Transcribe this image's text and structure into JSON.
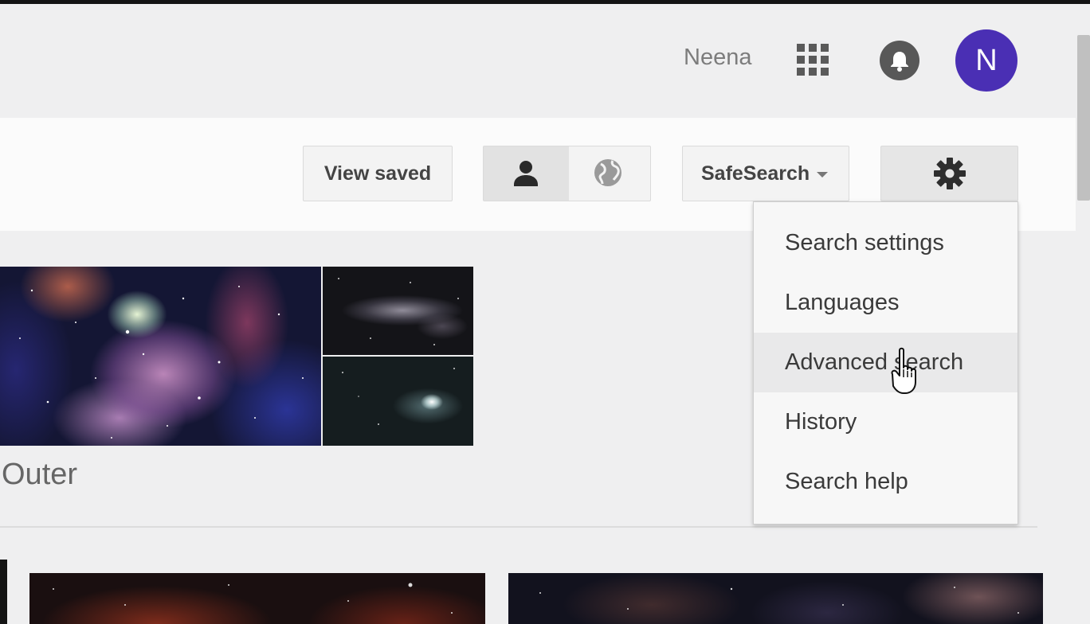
{
  "header": {
    "user_name": "Neena",
    "apps_icon": "apps-grid-icon",
    "notifications_icon": "bell-icon",
    "avatar_letter": "N",
    "avatar_color": "#4a2fb4"
  },
  "toolbar": {
    "view_saved_label": "View saved",
    "scope_toggle": {
      "person_icon": "person-icon",
      "globe_icon": "globe-icon",
      "selected": "person"
    },
    "safesearch_label": "SafeSearch",
    "settings_icon": "gear-icon"
  },
  "settings_menu": {
    "items": [
      {
        "label": "Search settings",
        "highlighted": false
      },
      {
        "label": "Languages",
        "highlighted": false
      },
      {
        "label": "Advanced search",
        "highlighted": true
      },
      {
        "label": "History",
        "highlighted": false
      },
      {
        "label": "Search help",
        "highlighted": false
      }
    ]
  },
  "results": {
    "collection_caption": "Outer"
  }
}
